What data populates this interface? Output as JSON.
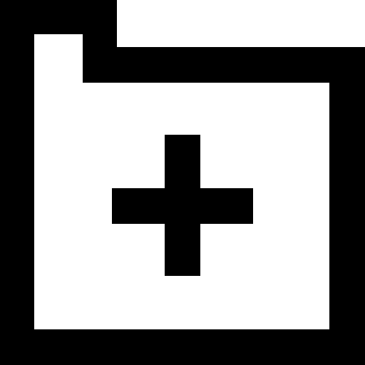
{
  "icon": {
    "name": "folder-add-icon",
    "fill_color": "#000000",
    "background_color": "#ffffff"
  }
}
